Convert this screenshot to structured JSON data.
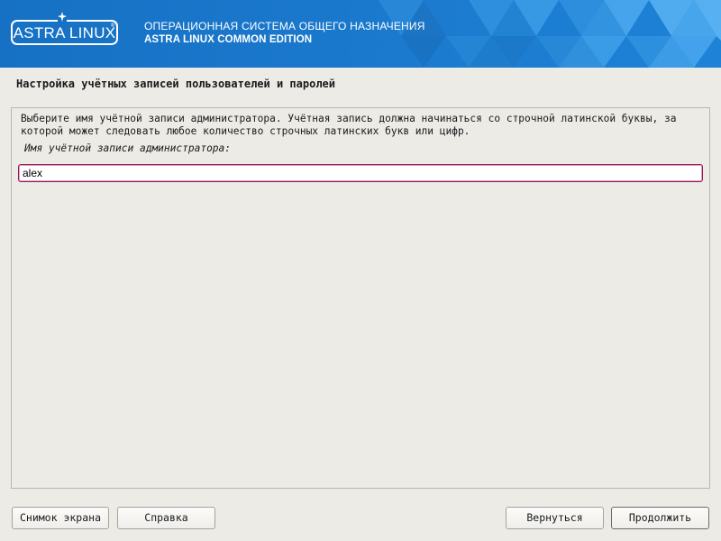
{
  "header": {
    "logo_text": "ASTRA LINUX",
    "logo_registered": "®",
    "os_line1": "ОПЕРАЦИОННАЯ СИСТЕМА ОБЩЕГО НАЗНАЧЕНИЯ",
    "os_line2": "ASTRA LINUX COMMON EDITION"
  },
  "page": {
    "title": "Настройка учётных записей пользователей и паролей"
  },
  "form": {
    "description": "Выберите имя учётной записи администратора. Учётная запись должна начинаться со строчной латинской буквы, за которой может следовать любое количество строчных латинских букв или цифр.",
    "field_label": "Имя учётной записи администратора:",
    "username_value": "alex"
  },
  "buttons": {
    "screenshot": "Снимок экрана",
    "help": "Справка",
    "back": "Вернуться",
    "continue": "Продолжить"
  },
  "colors": {
    "banner_blue": "#1a78cc",
    "background": "#edebe6",
    "input_focus_border": "#9c1257"
  }
}
